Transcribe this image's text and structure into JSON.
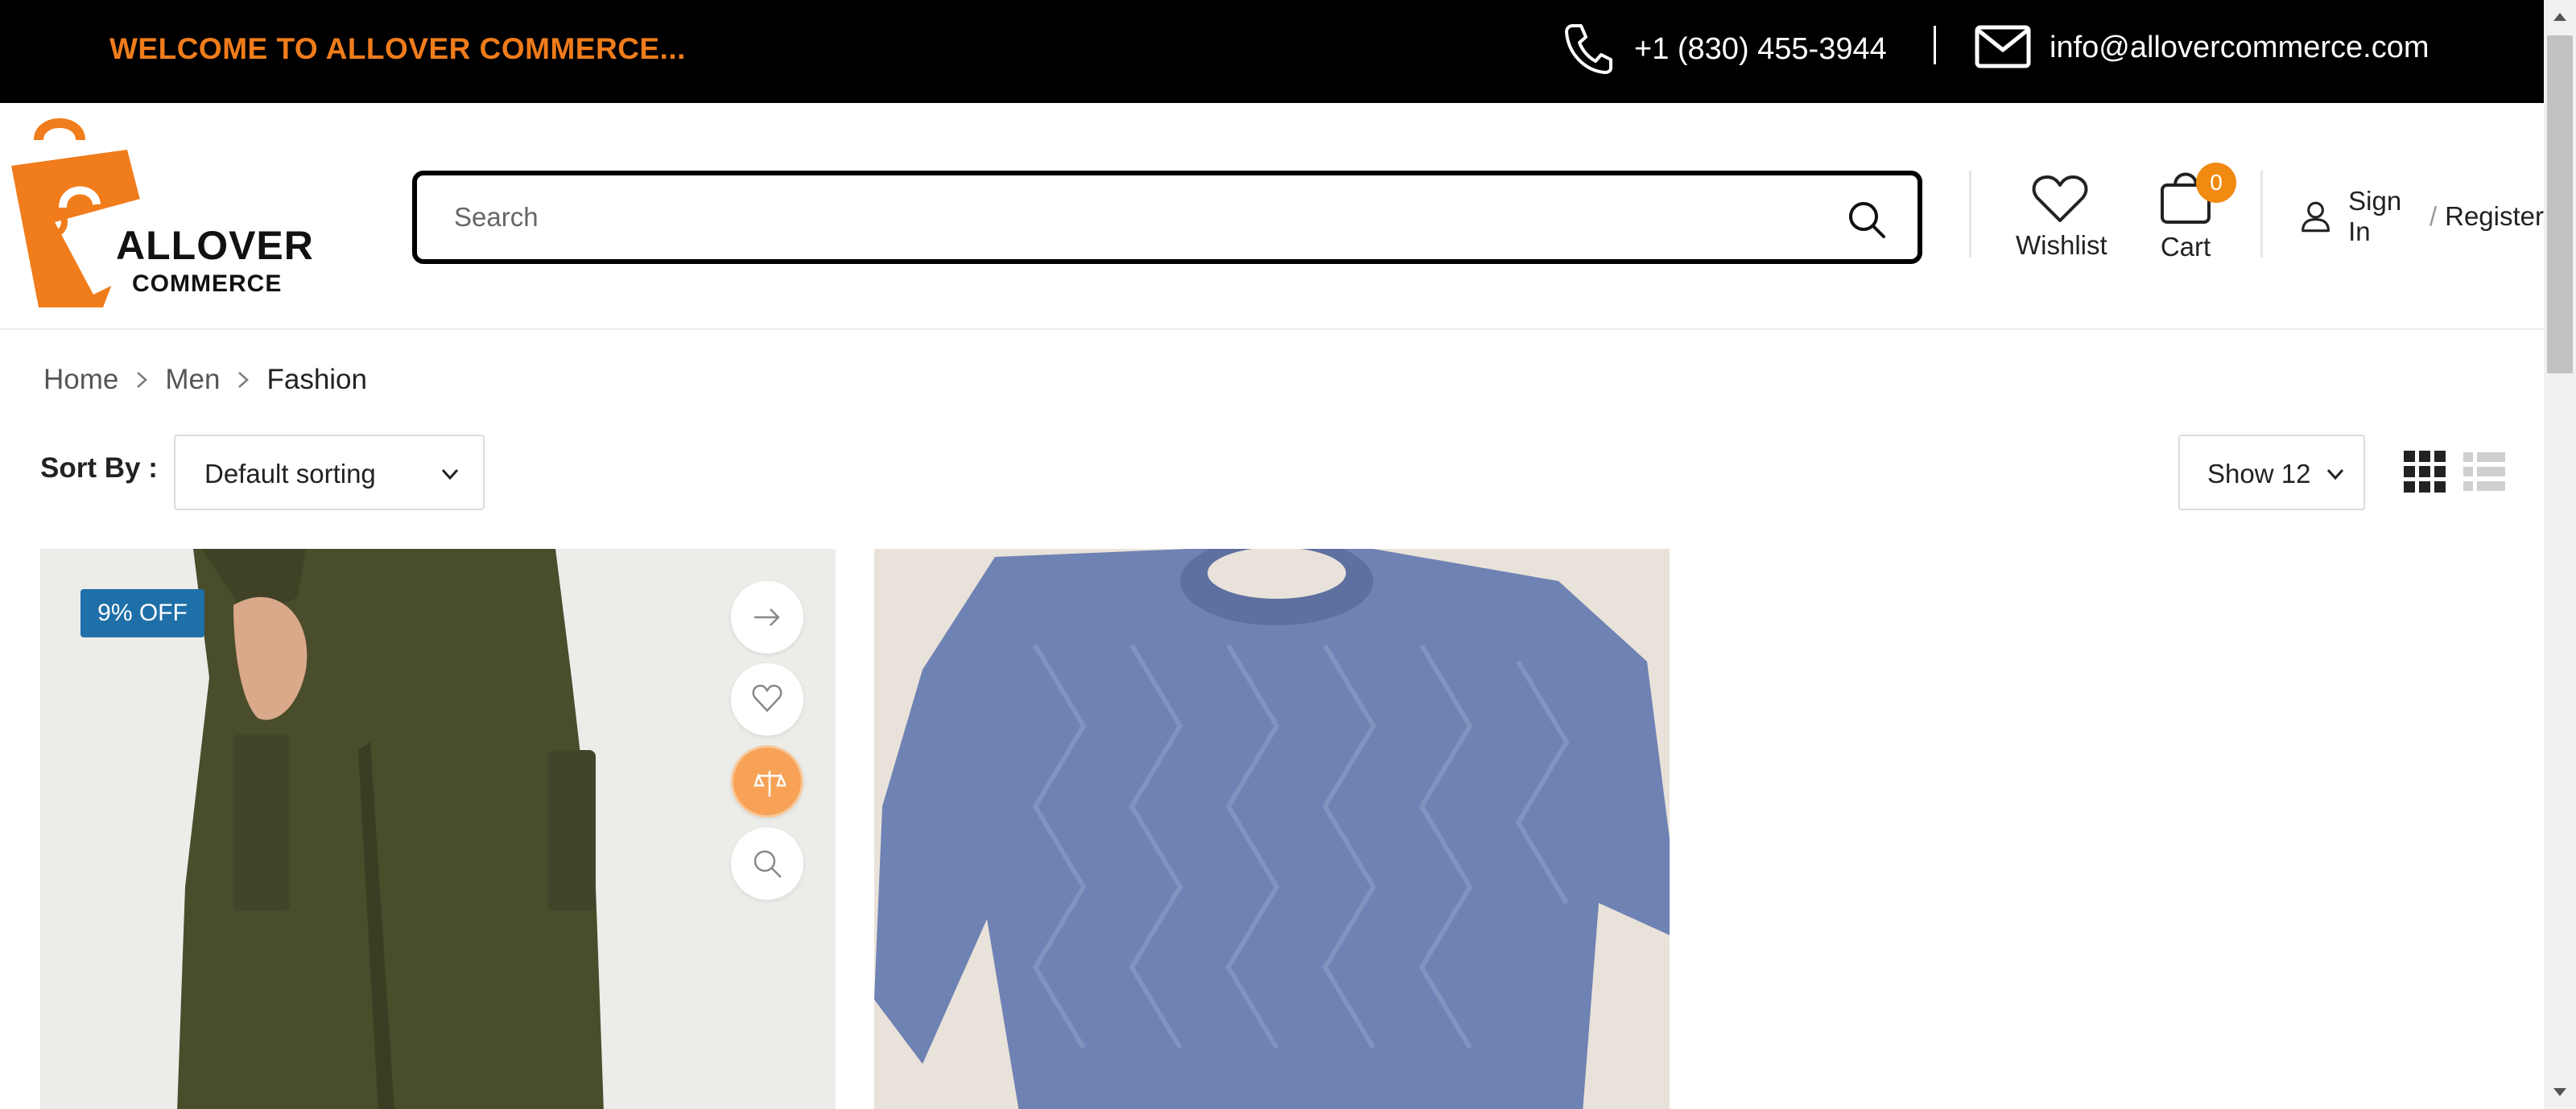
{
  "topbar": {
    "welcome": "WELCOME TO ALLOVER COMMERCE...",
    "phone": "+1 (830) 455-3944",
    "email": "info@allovercommerce.com"
  },
  "logo": {
    "line1": "ALLOVER",
    "line2": "COMMERCE"
  },
  "search": {
    "placeholder": "Search",
    "value": ""
  },
  "header_actions": {
    "wishlist_label": "Wishlist",
    "cart_label": "Cart",
    "cart_count": "0",
    "sign_in": "Sign In",
    "separator": "/",
    "register": "Register"
  },
  "breadcrumb": [
    "Home",
    "Men",
    "Fashion"
  ],
  "toolbar": {
    "sort_label": "Sort By :",
    "sort_value": "Default sorting",
    "show_value": "Show 12"
  },
  "products": [
    {
      "badge": "9% OFF",
      "image": "olive-cargo-pants",
      "actions": [
        "arrow-right-icon",
        "heart-icon",
        "compare-icon",
        "search-icon"
      ]
    },
    {
      "image": "blue-knit-sweater"
    }
  ],
  "colors": {
    "accent": "#f07c1b",
    "badge": "#1f6fa8",
    "cart_badge": "#f08a10",
    "topbar_bg": "#000000"
  }
}
